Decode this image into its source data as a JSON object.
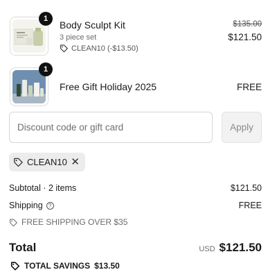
{
  "items": [
    {
      "name": "Body Sculpt Kit",
      "variant": "3 piece set",
      "discount": "CLEAN10 (-$13.50)",
      "quantity": "1",
      "original_price": "$135.00",
      "price": "$121.50"
    },
    {
      "name": "Free Gift Holiday 2025",
      "quantity": "1",
      "price": "FREE"
    }
  ],
  "discount": {
    "placeholder": "Discount code or gift card",
    "apply_label": "Apply",
    "applied_code": "CLEAN10"
  },
  "summary": {
    "subtotal_label": "Subtotal · 2 items",
    "subtotal_value": "$121.50",
    "shipping_label": "Shipping",
    "shipping_value": "FREE",
    "free_shipping_note": "FREE SHIPPING OVER $35",
    "total_label": "Total",
    "currency": "USD",
    "total_value": "$121.50",
    "savings_label": "TOTAL SAVINGS",
    "savings_value": "$13.50"
  },
  "icons": {
    "tag": "tag-icon",
    "close": "close-icon",
    "help": "help-icon",
    "savings": "savings-tag-icon"
  }
}
